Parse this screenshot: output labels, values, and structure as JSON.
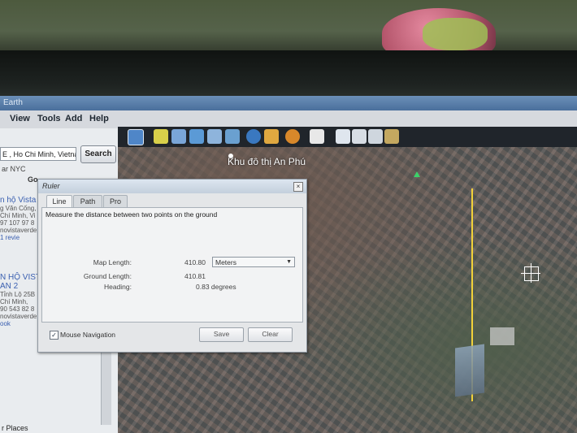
{
  "window": {
    "title": "Earth"
  },
  "menu": [
    "View",
    "Tools",
    "Add",
    "Help"
  ],
  "search": {
    "value": "E , Ho Chi Minh, Vietnam",
    "button": "Search",
    "hint": "ar NYC",
    "go": "Go"
  },
  "results": [
    {
      "title": "n hộ Vista",
      "lines": [
        "g Văn Cống,",
        "Chí Minh, Vi",
        "97 107 97 8",
        "novistaverde"
      ],
      "link": "1 revie"
    },
    {
      "title": "N HỘ VIST",
      "title2": "AN 2",
      "lines": [
        "Tỉnh Lộ 25B",
        "Chí Minh,",
        "90 543 82 8",
        "novistaverde"
      ],
      "link": "ook"
    }
  ],
  "places_label": "r Places",
  "map": {
    "label": "Khu đô thị An Phú"
  },
  "ruler": {
    "title": "Ruler",
    "tabs": [
      "Line",
      "Path",
      "Pro"
    ],
    "description": "Measure the distance between two points on the ground",
    "map_length_label": "Map Length:",
    "map_length_value": "410.80",
    "unit": "Meters",
    "ground_length_label": "Ground Length:",
    "ground_length_value": "410.81",
    "heading_label": "Heading:",
    "heading_value": "0.83 degrees",
    "mouse_nav_label": "Mouse Navigation",
    "mouse_nav_checked": true,
    "save": "Save",
    "clear": "Clear"
  },
  "toolbar_icons": [
    "sidebar-toggle-icon",
    "placemark-icon",
    "polygon-icon",
    "path-icon",
    "overlay-icon",
    "tour-icon",
    "earth-icon",
    "sunlight-icon",
    "planet-icon",
    "ruler-icon",
    "email-icon",
    "print-icon",
    "maps-icon",
    "kml-icon"
  ],
  "colors": {
    "measure_line": "#f2d23a",
    "placemark": "#3cd26a"
  }
}
